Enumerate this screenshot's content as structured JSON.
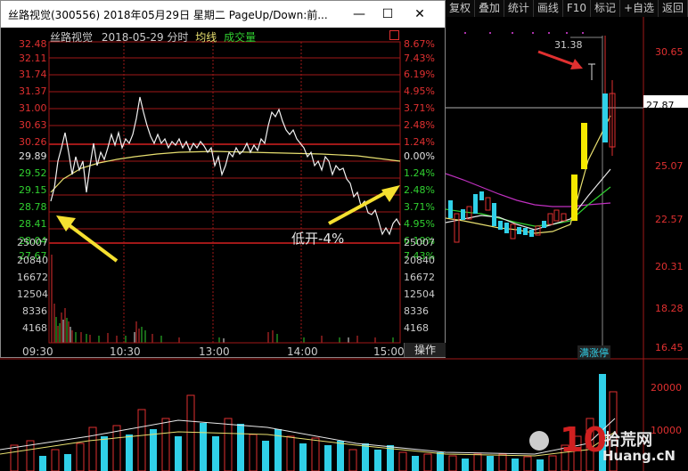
{
  "toolbar": {
    "items": [
      "复权",
      "叠加",
      "统计",
      "画线",
      "F10",
      "标记",
      "+自选",
      "返回"
    ]
  },
  "window": {
    "title": "丝路视觉(300556) 2018年05月29日 星期二 PageUp/Down:前...",
    "minimize_symbol": "—",
    "maximize_symbol": "☐",
    "close_symbol": "✕",
    "operate_label": "操作"
  },
  "intraday": {
    "stock_name": "丝路视觉",
    "date": "2018-05-29",
    "mode": "分时",
    "avg_label": "均线",
    "vol_label": "成交量",
    "price_ticks": [
      "32.48",
      "32.11",
      "31.74",
      "31.37",
      "31.00",
      "30.63",
      "30.26",
      "29.89",
      "29.52",
      "29.15",
      "28.78",
      "28.41",
      "28.04",
      "27.67"
    ],
    "pct_ticks": [
      "8.67%",
      "7.43%",
      "6.19%",
      "4.95%",
      "3.71%",
      "2.48%",
      "1.24%",
      "0.00%",
      "1.24%",
      "2.48%",
      "3.71%",
      "4.95%",
      "6.19%",
      "7.43%"
    ],
    "vol_ticks": [
      "25007",
      "20840",
      "16672",
      "12504",
      "8336",
      "4168"
    ],
    "time_ticks": [
      "09:30",
      "10:30",
      "13:00",
      "14:00",
      "15:00"
    ],
    "annotation": "低开-4%"
  },
  "daily": {
    "price_ticks": [
      "30.65",
      "27.87",
      "25.07",
      "22.57",
      "20.31",
      "18.28",
      "16.45"
    ],
    "current_price": "27.87",
    "high_label": "31.38",
    "vol_ticks": [
      "20000",
      "10000"
    ],
    "badge": "满涨停"
  },
  "watermark": {
    "text": "拾荒网",
    "url": "Huang.cN"
  },
  "colors": {
    "up": "#e03030",
    "down": "#30d0e8",
    "price_line": "#ffffff",
    "avg_line": "#e8e070",
    "arrow": "#f5e030",
    "grid": "#a01818"
  }
}
